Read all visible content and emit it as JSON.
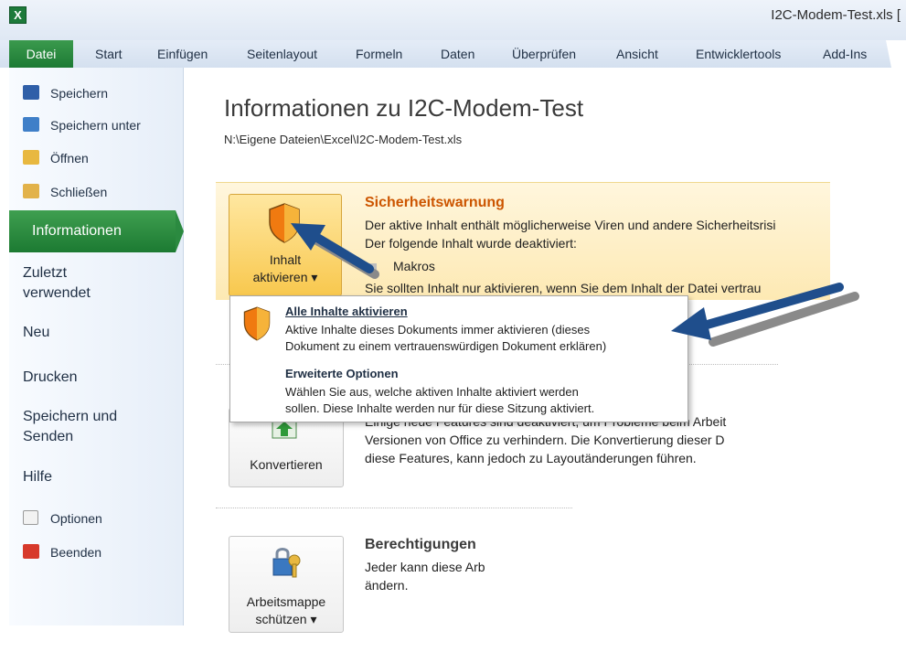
{
  "window": {
    "title": "I2C-Modem-Test.xls  [",
    "app_icon": "excel-icon"
  },
  "tabs": [
    "Start",
    "Einfügen",
    "Seitenlayout",
    "Formeln",
    "Daten",
    "Überprüfen",
    "Ansicht",
    "Entwicklertools",
    "Add-Ins"
  ],
  "datei_tab": "Datei",
  "nav": {
    "save": "Speichern",
    "save_as": "Speichern unter",
    "open": "Öffnen",
    "close": "Schließen",
    "info": "Informationen",
    "recent_1": "Zuletzt",
    "recent_2": "verwendet",
    "new": "Neu",
    "print": "Drucken",
    "send_1": "Speichern und",
    "send_2": "Senden",
    "help": "Hilfe",
    "options": "Optionen",
    "exit": "Beenden"
  },
  "main": {
    "title": "Informationen zu I2C-Modem-Test",
    "path": "N:\\Eigene Dateien\\Excel\\I2C-Modem-Test.xls"
  },
  "security": {
    "button_1": "Inhalt",
    "button_2": "aktivieren ▾",
    "title": "Sicherheitswarnung",
    "line1": "Der aktive Inhalt enthält möglicherweise Viren und andere Sicherheitsrisi",
    "line2": "Der folgende Inhalt wurde deaktiviert:",
    "bullet": "Makros",
    "line3": "Sie sollten Inhalt nur aktivieren, wenn Sie dem Inhalt der Datei vertrau"
  },
  "menu": {
    "item1_title": "Alle Inhalte aktivieren",
    "item1_desc_1": "Aktive Inhalte dieses Dokuments immer aktivieren (dieses",
    "item1_desc_2": "Dokument zu einem vertrauenswürdigen Dokument erklären)",
    "item2_title": "Erweiterte Optionen",
    "item2_desc_1": "Wählen Sie aus, welche aktiven Inhalte aktiviert werden",
    "item2_desc_2": "sollen. Diese Inhalte werden nur für diese Sitzung aktiviert."
  },
  "convert": {
    "button": "Konvertieren",
    "line1": "Einige neue Features sind deaktiviert, um Probleme beim Arbeit",
    "line2": "Versionen von Office zu verhindern. Die Konvertierung dieser D",
    "line3": "diese Features, kann jedoch zu Layoutänderungen führen."
  },
  "permissions": {
    "button_1": "Arbeitsmappe",
    "button_2": "schützen ▾",
    "title": "Berechtigungen",
    "line1": "Jeder kann diese Arb",
    "line2": "ändern."
  },
  "colors": {
    "accent_green": "#2b8a40",
    "warning_orange": "#cc5500",
    "arrow_blue": "#1f4e8c"
  }
}
